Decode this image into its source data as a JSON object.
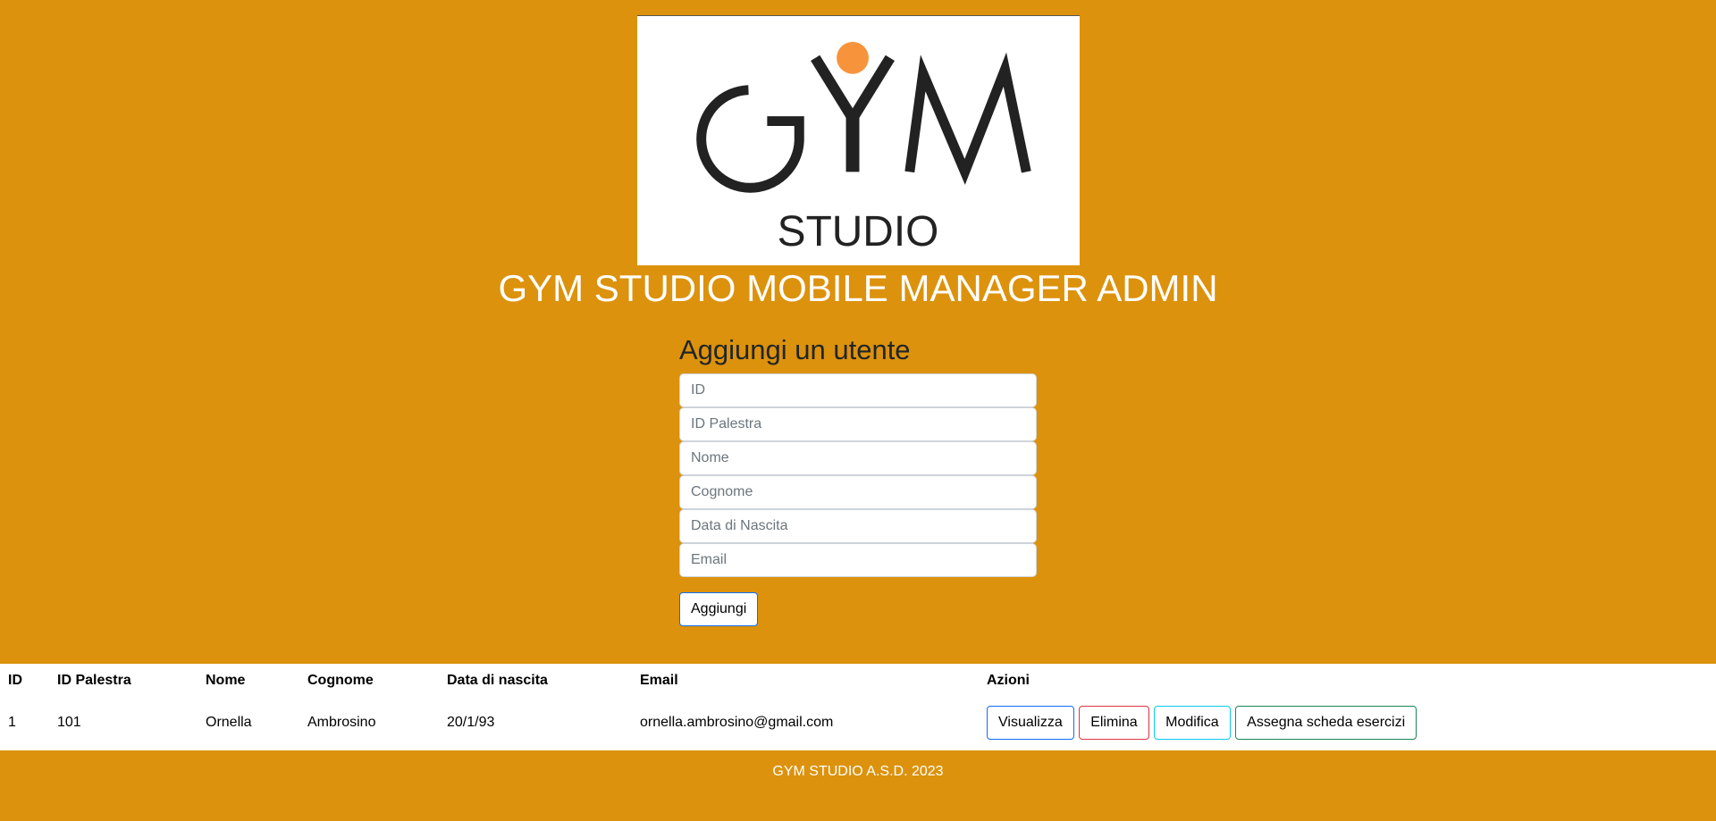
{
  "logo": {
    "text_main": "GYM",
    "text_sub": "STUDIO",
    "dot_color": "#f7943b"
  },
  "header": {
    "title": "GYM STUDIO MOBILE MANAGER ADMIN"
  },
  "form": {
    "title": "Aggiungi un utente",
    "placeholders": {
      "id": "ID",
      "gym_id": "ID Palestra",
      "name": "Nome",
      "surname": "Cognome",
      "birth": "Data di Nascita",
      "email": "Email"
    },
    "submit_label": "Aggiungi"
  },
  "table": {
    "headers": [
      "ID",
      "ID Palestra",
      "Nome",
      "Cognome",
      "Data di nascita",
      "Email",
      "Azioni"
    ],
    "rows": [
      {
        "id": "1",
        "gym_id": "101",
        "name": "Ornella",
        "surname": "Ambrosino",
        "birth": "20/1/93",
        "email": "ornella.ambrosino@gmail.com"
      }
    ],
    "actions": {
      "view": "Visualizza",
      "delete": "Elimina",
      "edit": "Modifica",
      "assign": "Assegna scheda esercizi"
    }
  },
  "footer": {
    "text": "GYM STUDIO A.S.D. 2023"
  },
  "colors": {
    "background": "#dc920c",
    "white": "#ffffff",
    "primary": "#0d6efd",
    "danger": "#dc3545",
    "info": "#0dcaf0",
    "success": "#198754"
  }
}
